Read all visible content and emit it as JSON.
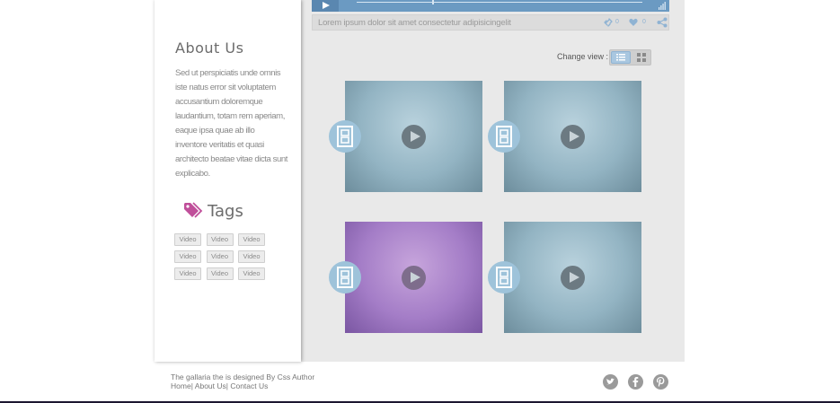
{
  "sidebar": {
    "about_title": "About Us",
    "about_text": "Sed ut perspiciatis unde omnis iste natus error sit voluptatem accusantium doloremque laudantium, totam rem aperiam, eaque ipsa quae ab illo inventore veritatis et quasi architecto beatae vitae dicta sunt explicabo.",
    "tags_title": "Tags",
    "tags": [
      "Video",
      "Video",
      "Video",
      "Video",
      "Video",
      "Video",
      "Video",
      "Video",
      "Video"
    ]
  },
  "player": {
    "caption": "Lorem ipsum dolor sit amet consectetur adipisicingelit",
    "link_count": "0",
    "like_count": "0"
  },
  "gallery": {
    "change_view_label": "Change view :",
    "videos": [
      {
        "tone": "blue"
      },
      {
        "tone": "blue"
      },
      {
        "tone": "purple"
      },
      {
        "tone": "blue"
      }
    ]
  },
  "footer": {
    "credit": "The gallaria the is designed By Css Author",
    "links": [
      "Home",
      "About Us",
      "Contact Us"
    ]
  },
  "icons": {
    "tag": "tag-icon",
    "film": "film-icon",
    "play": "play-icon",
    "twitter": "twitter-icon",
    "facebook": "facebook-icon",
    "pinterest": "pinterest-icon"
  },
  "colors": {
    "accent_blue": "#6b9ac2",
    "tag_pink": "#c04f9a",
    "film_badge": "#9ec3da"
  }
}
